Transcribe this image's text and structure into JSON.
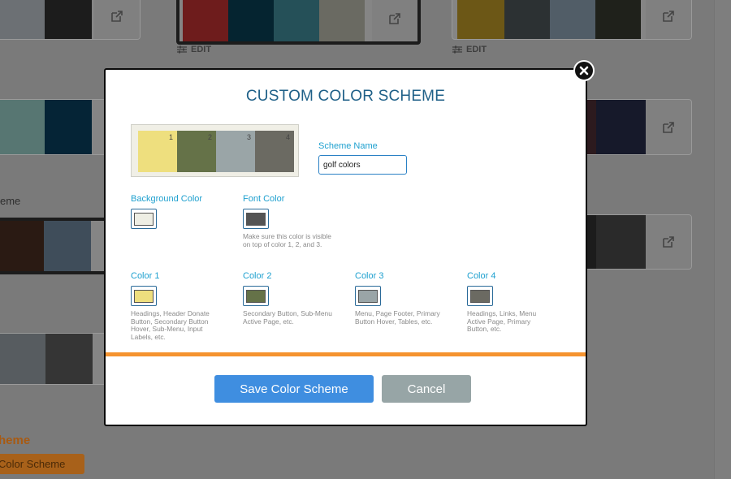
{
  "modal": {
    "title": "CUSTOM COLOR SCHEME",
    "preview_numbers": [
      "1",
      "2",
      "3",
      "4"
    ],
    "scheme_name_label": "Scheme Name",
    "scheme_name_value": "golf colors",
    "background_color": {
      "label": "Background Color",
      "value": "#eeeee4"
    },
    "font_color": {
      "label": "Font Color",
      "value": "#545454",
      "help": "Make sure this color is visible on top of color 1, 2, and 3."
    },
    "colors": [
      {
        "label": "Color 1",
        "value": "#eedf7e",
        "help": "Headings, Header Donate Button, Secondary Button Hover, Sub-Menu, Input Labels, etc."
      },
      {
        "label": "Color 2",
        "value": "#657248",
        "help": "Secondary Button, Sub-Menu Active Page, etc."
      },
      {
        "label": "Color 3",
        "value": "#9aa5a7",
        "help": "Menu, Page Footer, Primary Button Hover, Tables, etc."
      },
      {
        "label": "Color 4",
        "value": "#6b6a62",
        "help": "Headings, Links, Menu Active Page, Primary Button, etc."
      }
    ],
    "save_label": "Save Color Scheme",
    "cancel_label": "Cancel",
    "accent_divider_color": "#f5932f"
  },
  "background": {
    "edit_label": "EDIT",
    "partial_label_1": "eme",
    "partial_heading": "heme",
    "partial_button": "Color Scheme"
  }
}
